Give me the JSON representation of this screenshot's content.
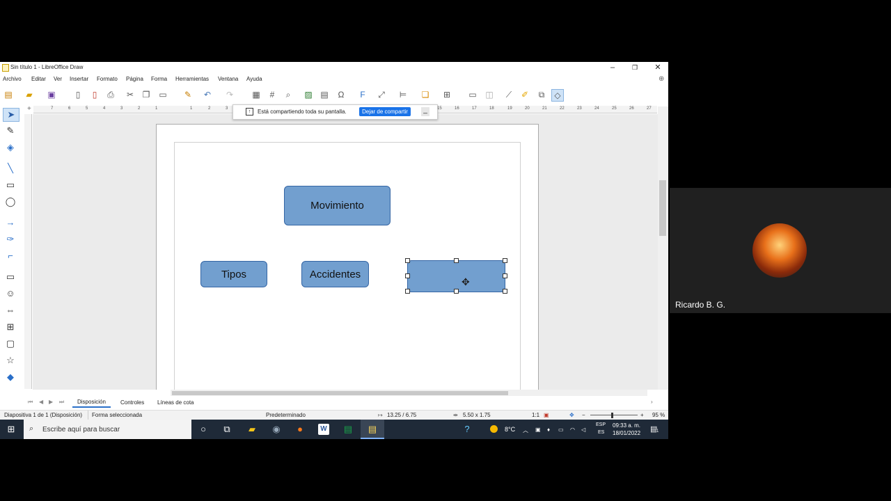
{
  "window": {
    "title": "Sin título 1 - LibreOffice Draw"
  },
  "menu": [
    "Archivo",
    "Editar",
    "Ver",
    "Insertar",
    "Formato",
    "Página",
    "Forma",
    "Herramientas",
    "Ventana",
    "Ayuda"
  ],
  "share_bar": {
    "message": "Está compartiendo toda su pantalla.",
    "stop_button": "Dejar de compartir",
    "minimize": "_"
  },
  "shapes": {
    "top": "Movimiento",
    "left": "Tipos",
    "middle": "Accidentes",
    "right": ""
  },
  "hruler_ticks": [
    "7",
    "6",
    "5",
    "4",
    "3",
    "2",
    "1",
    "1",
    "2",
    "3",
    "15",
    "16",
    "17",
    "18",
    "19",
    "20",
    "21",
    "22",
    "23",
    "24",
    "25",
    "26",
    "27"
  ],
  "tabs": [
    "Disposición",
    "Controles",
    "Líneas de cota"
  ],
  "status": {
    "slide": "Diapositiva 1 de 1 (Disposición)",
    "selection": "Forma seleccionada",
    "style": "Predeterminado",
    "position": "13.25 / 6.75",
    "size": "5.50 x 1.75",
    "scale": "1:1",
    "zoom": "95 %"
  },
  "taskbar": {
    "search_placeholder": "Escribe aquí para buscar",
    "weather": "8°C",
    "lang_top": "ESP",
    "lang_bottom": "ES",
    "time": "09:33 a. m.",
    "date": "18/01/2022",
    "notif_count": "1"
  },
  "participant": {
    "name": "Ricardo B. G."
  }
}
